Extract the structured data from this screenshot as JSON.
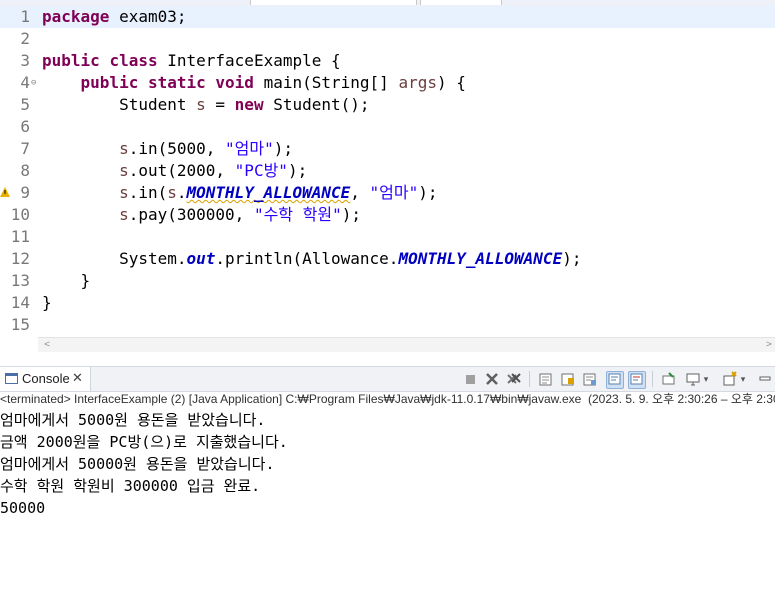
{
  "editor": {
    "lines": [
      {
        "num": "1",
        "parts": [
          {
            "t": "package",
            "c": "kw"
          },
          {
            "t": " exam03;",
            "c": ""
          }
        ]
      },
      {
        "num": "2",
        "parts": []
      },
      {
        "num": "3",
        "parts": [
          {
            "t": "public",
            "c": "kw"
          },
          {
            "t": " ",
            "c": ""
          },
          {
            "t": "class",
            "c": "kw"
          },
          {
            "t": " InterfaceExample {",
            "c": ""
          }
        ]
      },
      {
        "num": "4",
        "fold": "⊖",
        "parts": [
          {
            "t": "    ",
            "c": ""
          },
          {
            "t": "public",
            "c": "kw"
          },
          {
            "t": " ",
            "c": ""
          },
          {
            "t": "static",
            "c": "kw"
          },
          {
            "t": " ",
            "c": ""
          },
          {
            "t": "void",
            "c": "kw"
          },
          {
            "t": " main(String[] ",
            "c": ""
          },
          {
            "t": "args",
            "c": "prm"
          },
          {
            "t": ") {",
            "c": ""
          }
        ]
      },
      {
        "num": "5",
        "parts": [
          {
            "t": "        Student ",
            "c": ""
          },
          {
            "t": "s",
            "c": "prm"
          },
          {
            "t": " = ",
            "c": ""
          },
          {
            "t": "new",
            "c": "kw"
          },
          {
            "t": " Student();",
            "c": ""
          }
        ]
      },
      {
        "num": "6",
        "parts": []
      },
      {
        "num": "7",
        "parts": [
          {
            "t": "        ",
            "c": ""
          },
          {
            "t": "s",
            "c": "prm"
          },
          {
            "t": ".in(5000, ",
            "c": ""
          },
          {
            "t": "\"엄마\"",
            "c": "str"
          },
          {
            "t": ");",
            "c": ""
          }
        ]
      },
      {
        "num": "8",
        "parts": [
          {
            "t": "        ",
            "c": ""
          },
          {
            "t": "s",
            "c": "prm"
          },
          {
            "t": ".out(2000, ",
            "c": ""
          },
          {
            "t": "\"PC방\"",
            "c": "str"
          },
          {
            "t": ");",
            "c": ""
          }
        ]
      },
      {
        "num": "9",
        "warn": true,
        "parts": [
          {
            "t": "        ",
            "c": ""
          },
          {
            "t": "s",
            "c": "prm"
          },
          {
            "t": ".in(",
            "c": ""
          },
          {
            "t": "s",
            "c": "prm"
          },
          {
            "t": ".",
            "c": ""
          },
          {
            "t": "MONTHLY_ALLOWANCE",
            "c": "fld squig"
          },
          {
            "t": ", ",
            "c": ""
          },
          {
            "t": "\"엄마\"",
            "c": "str"
          },
          {
            "t": ");",
            "c": ""
          }
        ]
      },
      {
        "num": "10",
        "parts": [
          {
            "t": "        ",
            "c": ""
          },
          {
            "t": "s",
            "c": "prm"
          },
          {
            "t": ".pay(300000, ",
            "c": ""
          },
          {
            "t": "\"수학 학원\"",
            "c": "str"
          },
          {
            "t": ");",
            "c": ""
          }
        ]
      },
      {
        "num": "11",
        "parts": []
      },
      {
        "num": "12",
        "parts": [
          {
            "t": "        System.",
            "c": ""
          },
          {
            "t": "out",
            "c": "fld"
          },
          {
            "t": ".println(Allowance.",
            "c": ""
          },
          {
            "t": "MONTHLY_ALLOWANCE",
            "c": "fld"
          },
          {
            "t": ");",
            "c": ""
          }
        ]
      },
      {
        "num": "13",
        "parts": [
          {
            "t": "    }",
            "c": ""
          }
        ]
      },
      {
        "num": "14",
        "parts": [
          {
            "t": "}",
            "c": ""
          }
        ]
      },
      {
        "num": "15",
        "parts": []
      }
    ]
  },
  "console": {
    "tab_label": "Console",
    "close_glyph": "✕",
    "status": "<terminated> InterfaceExample (2) [Java Application] C:₩Program Files₩Java₩jdk-11.0.17₩bin₩javaw.exe  (2023. 5. 9. 오후 2:30:26 – 오후 2:30",
    "output": [
      "엄마에게서 5000원 용돈을 받았습니다.",
      "금액 2000원을 PC방(으)로 지출했습니다.",
      "엄마에게서 50000원 용돈을 받았습니다.",
      "수학 학원 학원비 300000 입금 완료.",
      "50000"
    ]
  },
  "icons": {
    "terminate": "square-icon",
    "remove": "close-icon",
    "remove_all": "close-all-icon",
    "clear": "clear-console-icon",
    "scroll_lock": "scroll-lock-icon",
    "word_wrap": "word-wrap-icon",
    "show_stdout": "show-stdout-icon",
    "show_stderr": "show-stderr-icon",
    "pin": "pin-icon",
    "display_console": "monitor-icon",
    "open_console": "new-console-icon",
    "minimize": "minimize-icon"
  },
  "colors": {
    "keyword": "#7f0055",
    "string": "#2a00ff",
    "field": "#0000c0",
    "param": "#6a3e3e",
    "current_line": "#e8f2fe"
  }
}
